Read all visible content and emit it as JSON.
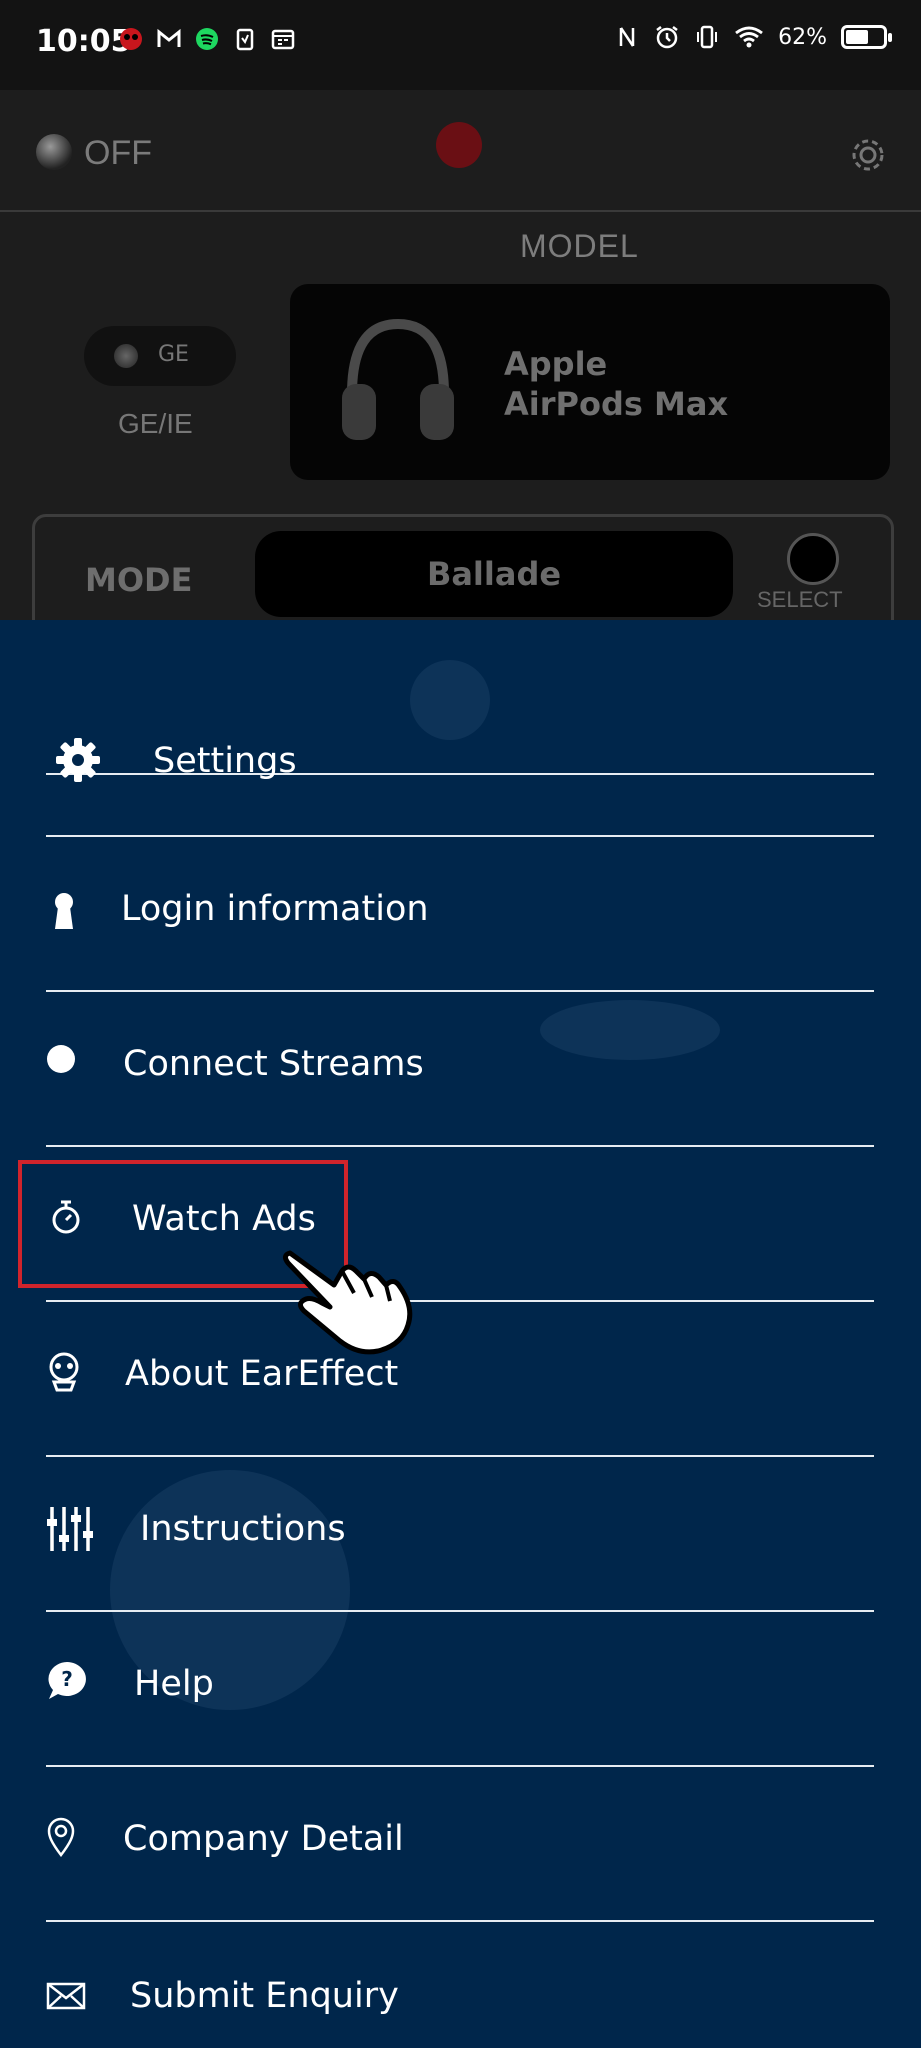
{
  "status_bar": {
    "time": "10:05",
    "battery_percent": "62%",
    "battery_level": 0.62,
    "left_icons": [
      "app-logo-icon",
      "gmail-icon",
      "spotify-icon",
      "clipboard-icon",
      "calendar-icon"
    ],
    "right_icons": [
      "nfc-icon",
      "alarm-icon",
      "vibrate-icon",
      "wifi-icon",
      "battery-icon"
    ]
  },
  "app_header": {
    "power_label": "OFF",
    "model_title": "MODEL",
    "ge_toggle_label": "GE",
    "ge_ie_label": "GE/IE",
    "model_name_line1": "Apple",
    "model_name_line2": "AirPods Max",
    "mode_label": "MODE",
    "mode_value": "Ballade",
    "select_label": "SELECT"
  },
  "drawer": {
    "items": [
      {
        "label": "Settings",
        "icon": "gear-icon"
      },
      {
        "label": "Login information",
        "icon": "keyhole-icon"
      },
      {
        "label": "Connect Streams",
        "icon": "dot-icon"
      },
      {
        "label": "Watch Ads",
        "icon": "stopwatch-icon"
      },
      {
        "label": "About EarEffect",
        "icon": "mascot-icon"
      },
      {
        "label": "Instructions",
        "icon": "sliders-icon"
      },
      {
        "label": "Help",
        "icon": "help-bubble-icon"
      },
      {
        "label": "Company Detail",
        "icon": "location-pin-icon"
      },
      {
        "label": "Submit Enquiry",
        "icon": "envelope-icon"
      }
    ],
    "highlighted_item": "Watch Ads",
    "pointer_icon": "pointing-hand-icon"
  },
  "colors": {
    "drawer_bg": "#00264b",
    "highlight": "#d0242c",
    "text": "#ffffff"
  }
}
